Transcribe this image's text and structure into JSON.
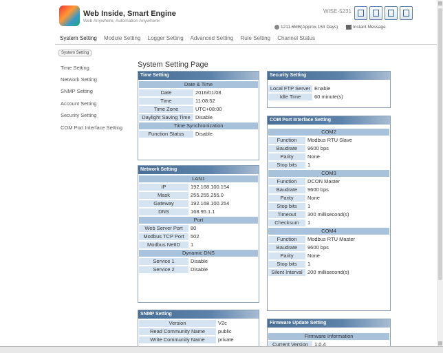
{
  "header": {
    "brand": "Web Inside, Smart Engine",
    "tagline": "Web Anywhere, Automation Anywhere!",
    "model": "WISE-5231",
    "storage": "1211.6MB(Approx.153 Days)",
    "instant_message": "Instant Message"
  },
  "nav": {
    "tabs": [
      "System Setting",
      "Module Setting",
      "Logger Setting",
      "Advanced Setting",
      "Rule Setting",
      "Channel Status"
    ],
    "breadcrumb": "System Setting"
  },
  "sidebar": {
    "items": [
      "Time Setting",
      "Network Setting",
      "SNMP Setting",
      "Account Setting",
      "Security Setting",
      "COM Port Interface Setting"
    ]
  },
  "page_title": "System Setting Page",
  "time": {
    "title": "Time Setting",
    "sec1": "Date & Time",
    "date_l": "Date",
    "date_v": "2016/01/08",
    "time_l": "Time",
    "time_v": "11:08:52",
    "tz_l": "Time Zone",
    "tz_v": "UTC+08:00",
    "dst_l": "Daylight Saving Time",
    "dst_v": "Disable",
    "sec2": "Time Synchronization",
    "fs_l": "Function Status",
    "fs_v": "Disable"
  },
  "network": {
    "title": "Network Setting",
    "sec1": "LAN1",
    "ip_l": "IP",
    "ip_v": "192.168.100.154",
    "mask_l": "Mask",
    "mask_v": "255.255.255.0",
    "gw_l": "Gateway",
    "gw_v": "192.168.100.254",
    "dns_l": "DNS",
    "dns_v": "168.95.1.1",
    "sec2": "Port",
    "web_l": "Web Server Port",
    "web_v": "80",
    "mtcp_l": "Modbus TCP Port",
    "mtcp_v": "502",
    "mid_l": "Modbus NetID",
    "mid_v": "1",
    "sec3": "Dynamic DNS",
    "s1_l": "Service 1",
    "s1_v": "Disable",
    "s2_l": "Service 2",
    "s2_v": "Disable"
  },
  "snmp": {
    "title": "SNMP Setting",
    "ver_l": "Version",
    "ver_v": "V2c",
    "rc_l": "Read Community Name",
    "rc_v": "public",
    "wc_l": "Write Community Name",
    "wc_v": "private"
  },
  "security": {
    "title": "Security Setting",
    "ftp_l": "Local FTP Server",
    "ftp_v": "Enable",
    "idle_l": "Idle Time",
    "idle_v": "60 minute(s)"
  },
  "com": {
    "title": "COM Port Interface Setting",
    "c2": "COM2",
    "c2_fn_l": "Function",
    "c2_fn_v": "Modbus RTU Slave",
    "c2_bd_l": "Baudrate",
    "c2_bd_v": "9600 bps",
    "c2_pa_l": "Parity",
    "c2_pa_v": "None",
    "c2_sb_l": "Stop bits",
    "c2_sb_v": "1",
    "c3": "COM3",
    "c3_fn_l": "Function",
    "c3_fn_v": "DCON Master",
    "c3_bd_l": "Baudrate",
    "c3_bd_v": "9600 bps",
    "c3_pa_l": "Parity",
    "c3_pa_v": "None",
    "c3_sb_l": "Stop bits",
    "c3_sb_v": "1",
    "c3_to_l": "Timeout",
    "c3_to_v": "300 millisecond(s)",
    "c3_cs_l": "Checksum",
    "c3_cs_v": "1",
    "c4": "COM4",
    "c4_fn_l": "Function",
    "c4_fn_v": "Modbus RTU Master",
    "c4_bd_l": "Baudrate",
    "c4_bd_v": "9600 bps",
    "c4_pa_l": "Parity",
    "c4_pa_v": "None",
    "c4_sb_l": "Stop bits",
    "c4_sb_v": "1",
    "c4_si_l": "Silent Interval",
    "c4_si_v": "200 millisecond(s)"
  },
  "firmware": {
    "title": "Firmware Update Setting",
    "sec1": "Firmware Information",
    "cv_l": "Current Version",
    "cv_v": "1.0.4"
  }
}
